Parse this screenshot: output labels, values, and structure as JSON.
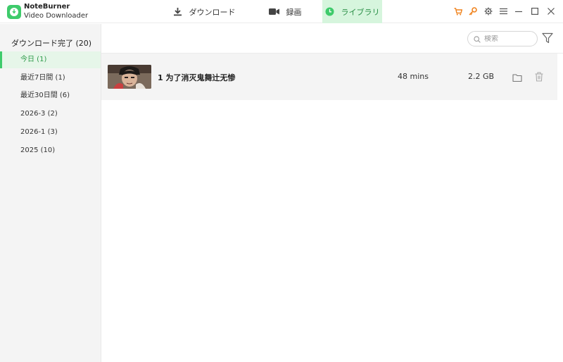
{
  "app": {
    "name": "NoteBurner",
    "subtitle": "Video Downloader"
  },
  "tabs": [
    {
      "label": "ダウンロード",
      "icon": "download-icon",
      "active": false
    },
    {
      "label": "録画",
      "icon": "video-camera-icon",
      "active": false
    },
    {
      "label": "ライブラリ",
      "icon": "clock-icon",
      "active": true
    }
  ],
  "window_icons": [
    "cart-icon",
    "key-icon",
    "gear-icon",
    "menu-icon",
    "minimize-icon",
    "maximize-icon",
    "close-icon"
  ],
  "colors": {
    "accent": "#3ecb6b",
    "accent_text": "#2e9a4a",
    "active_tab_bg": "#d6f5dd",
    "orange": "#f0831e"
  },
  "sidebar": {
    "title": "ダウンロード完了 (20)",
    "items": [
      {
        "label": "今日 (1)",
        "active": true
      },
      {
        "label": "最近7日間 (1)",
        "active": false
      },
      {
        "label": "最近30日間 (6)",
        "active": false
      },
      {
        "label": "2026-3 (2)",
        "active": false
      },
      {
        "label": "2026-1 (3)",
        "active": false
      },
      {
        "label": "2025 (10)",
        "active": false
      }
    ]
  },
  "search": {
    "placeholder": "検索"
  },
  "videos": [
    {
      "title": "1 为了消灭鬼舞辻无惨",
      "duration": "48 mins",
      "size": "2.2 GB"
    }
  ]
}
